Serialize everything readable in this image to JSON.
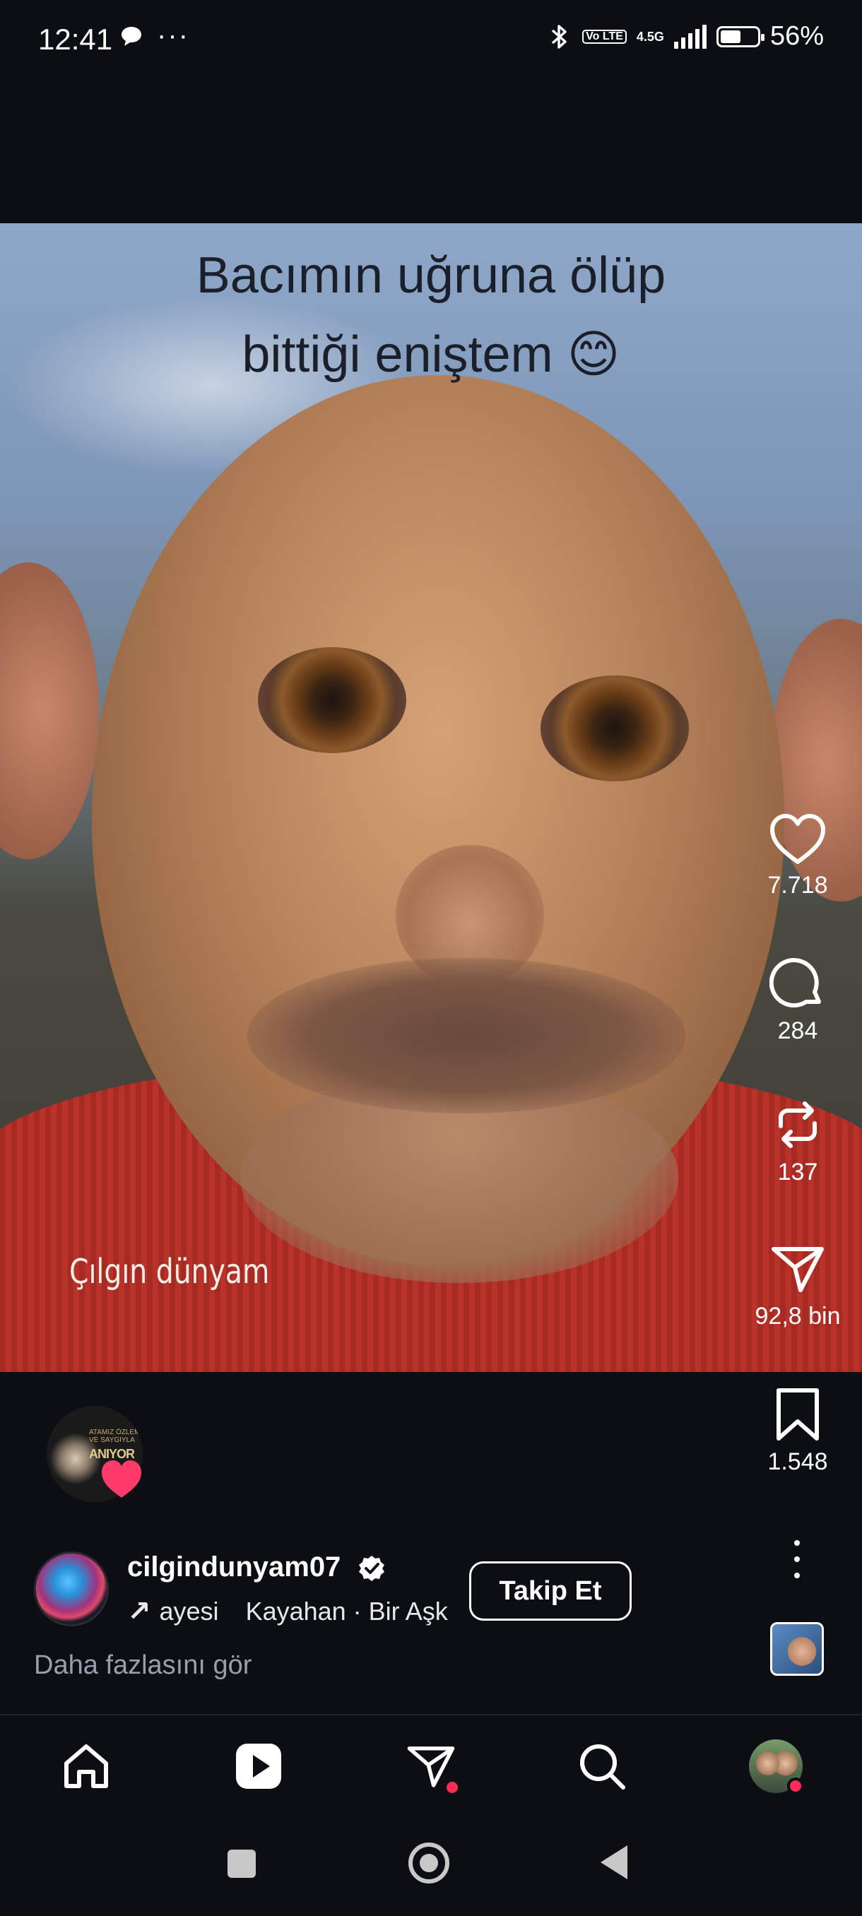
{
  "status_bar": {
    "time": "12:41",
    "dots": "···",
    "network_4g": "4.5G",
    "lte": "Vo LTE",
    "battery": "56%",
    "battery_level": 0.56
  },
  "video": {
    "caption_line1": "Bacımın uğruna ölüp",
    "caption_line2": "bittiği eniştem 😊",
    "watermark": "Çılgın dünyam"
  },
  "actions": {
    "likes": "7.718",
    "comments": "284",
    "reposts": "137",
    "shares": "92,8 bin",
    "saves": "1.548"
  },
  "story": {
    "label_small": "ATAMIZ ÖZLEM VE SAYGIYLA",
    "label_big": "ANIYOR"
  },
  "author": {
    "username": "cilgindunyam07",
    "audio_left": "ayesi",
    "audio_right": "Kayahan · Bir Aşk",
    "follow_label": "Takip Et",
    "see_more": "Daha fazlasını gör"
  },
  "colors": {
    "background": "#0b0f14",
    "notification": "#ff2d55",
    "heart": "#ff3b6b",
    "muted_text": "#9aa0a8"
  }
}
